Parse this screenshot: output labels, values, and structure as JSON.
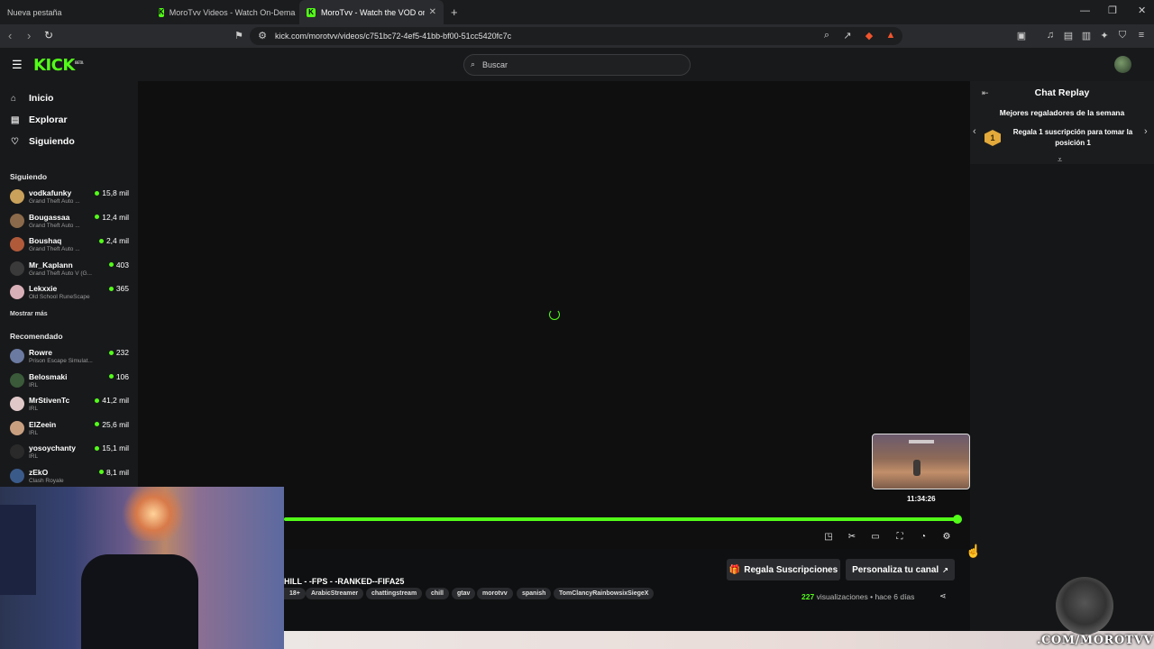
{
  "browser": {
    "tabs": [
      {
        "title": "Nueva pestaña"
      },
      {
        "title": "MoroTvv Videos - Watch On-Demand"
      },
      {
        "title": "MoroTvv - Watch the VOD on Kick"
      }
    ],
    "url": "kick.com/morotvv/videos/c751bc72-4ef5-41bb-bf00-51cc5420fc7c"
  },
  "header": {
    "logo": "KICK",
    "logo_badge": "BETA",
    "search_placeholder": "Buscar"
  },
  "sidebar": {
    "nav": [
      {
        "label": "Inicio",
        "icon": "home-icon"
      },
      {
        "label": "Explorar",
        "icon": "compass-icon"
      },
      {
        "label": "Siguiendo",
        "icon": "heart-icon"
      }
    ],
    "following_heading": "Siguiendo",
    "following": [
      {
        "name": "vodkafunky",
        "game": "Grand Theft Auto ...",
        "viewers": "15,8 mil",
        "color": "#c9a15a"
      },
      {
        "name": "Bougassaa",
        "game": "Grand Theft Auto ...",
        "viewers": "12,4 mil",
        "color": "#8a6a4a"
      },
      {
        "name": "Boushaq",
        "game": "Grand Theft Auto ...",
        "viewers": "2,4 mil",
        "color": "#b05a3a"
      },
      {
        "name": "Mr_Kaplann",
        "game": "Grand Theft Auto V (G...",
        "viewers": "403",
        "color": "#3a3a3a"
      },
      {
        "name": "Lekxxie",
        "game": "Old School RuneScape",
        "viewers": "365",
        "color": "#d8b0b8"
      }
    ],
    "show_more": "Mostrar más",
    "recommended_heading": "Recomendado",
    "recommended": [
      {
        "name": "Rowre",
        "game": "Prison Escape Simulat...",
        "viewers": "232",
        "color": "#6a7aa0"
      },
      {
        "name": "Belosmaki",
        "game": "IRL",
        "viewers": "106",
        "color": "#3a5a3a"
      },
      {
        "name": "MrStivenTc",
        "game": "IRL",
        "viewers": "41,2 mil",
        "color": "#e0c8c8"
      },
      {
        "name": "ElZeein",
        "game": "IRL",
        "viewers": "25,6 mil",
        "color": "#c8a080"
      },
      {
        "name": "yosoychanty",
        "game": "IRL",
        "viewers": "15,1 mil",
        "color": "#2a2a2a"
      },
      {
        "name": "zEkO",
        "game": "Clash Royale",
        "viewers": "8,1 mil",
        "color": "#3a5a8a"
      }
    ]
  },
  "player": {
    "preview_time": "11:34:26",
    "progress": 0.99
  },
  "video": {
    "title": "HILL - -FPS - -RANKED--FIFA25",
    "tags": [
      "18+",
      "ArabicStreamer",
      "chattingstream",
      "chill",
      "gtav",
      "morotvv",
      "spanish",
      "TomClancyRainbowsixSiegeX"
    ],
    "gift_button": "Regala Suscripciones",
    "customize_button": "Personaliza tu canal",
    "views_count": "227",
    "views_label": "visualizaciones",
    "time_ago": "hace 6 días"
  },
  "chat": {
    "title": "Chat Replay",
    "gifters_heading": "Mejores regaladores de la semana",
    "rank": "1",
    "gift_prompt": "Regala 1 suscripción para tomar la posición 1"
  },
  "overlay": {
    "watermark": ".COM/MOROTVV"
  },
  "colors": {
    "accent": "#53fc18",
    "background": "#0b0e0f",
    "sidebar": "#18191b"
  }
}
